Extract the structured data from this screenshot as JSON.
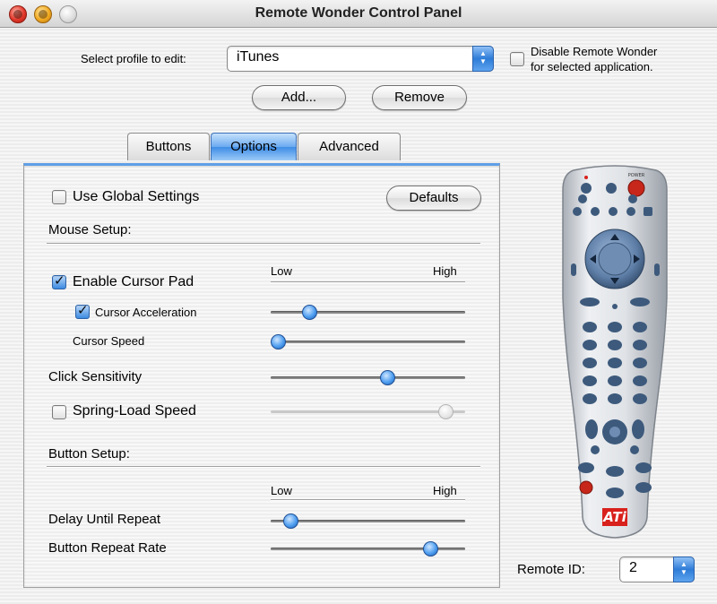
{
  "window": {
    "title": "Remote Wonder Control Panel"
  },
  "profile": {
    "label": "Select profile to edit:",
    "selected": "iTunes",
    "disable_label_line1": "Disable Remote Wonder",
    "disable_label_line2": "for selected application.",
    "disable_checked": false
  },
  "buttons": {
    "add": "Add...",
    "remove": "Remove",
    "defaults": "Defaults"
  },
  "tabs": [
    {
      "label": "Buttons",
      "active": false
    },
    {
      "label": "Options",
      "active": true
    },
    {
      "label": "Advanced",
      "active": false
    }
  ],
  "options": {
    "use_global": {
      "label": "Use Global Settings",
      "checked": false
    },
    "mouse_setup": "Mouse Setup:",
    "low": "Low",
    "high": "High",
    "enable_cursor_pad": {
      "label": "Enable Cursor Pad",
      "checked": true
    },
    "cursor_acceleration": {
      "label": "Cursor Acceleration",
      "checked": true,
      "value": 0.2
    },
    "cursor_speed": {
      "label": "Cursor Speed",
      "value": 0.0
    },
    "click_sensitivity": {
      "label": "Click Sensitivity",
      "value": 0.6
    },
    "spring_load_speed": {
      "label": "Spring-Load Speed",
      "checked": false,
      "value": 0.9,
      "enabled": false
    },
    "button_setup": "Button Setup:",
    "delay_until_repeat": {
      "label": "Delay Until Repeat",
      "value": 0.1
    },
    "button_repeat_rate": {
      "label": "Button Repeat Rate",
      "value": 0.82
    }
  },
  "remote": {
    "power_label": "POWER",
    "logo": "ATi",
    "id_label": "Remote ID:",
    "id_value": "2"
  },
  "colors": {
    "accent": "#3e8de6",
    "power": "#cc2b1d",
    "logo": "#d8211c"
  }
}
